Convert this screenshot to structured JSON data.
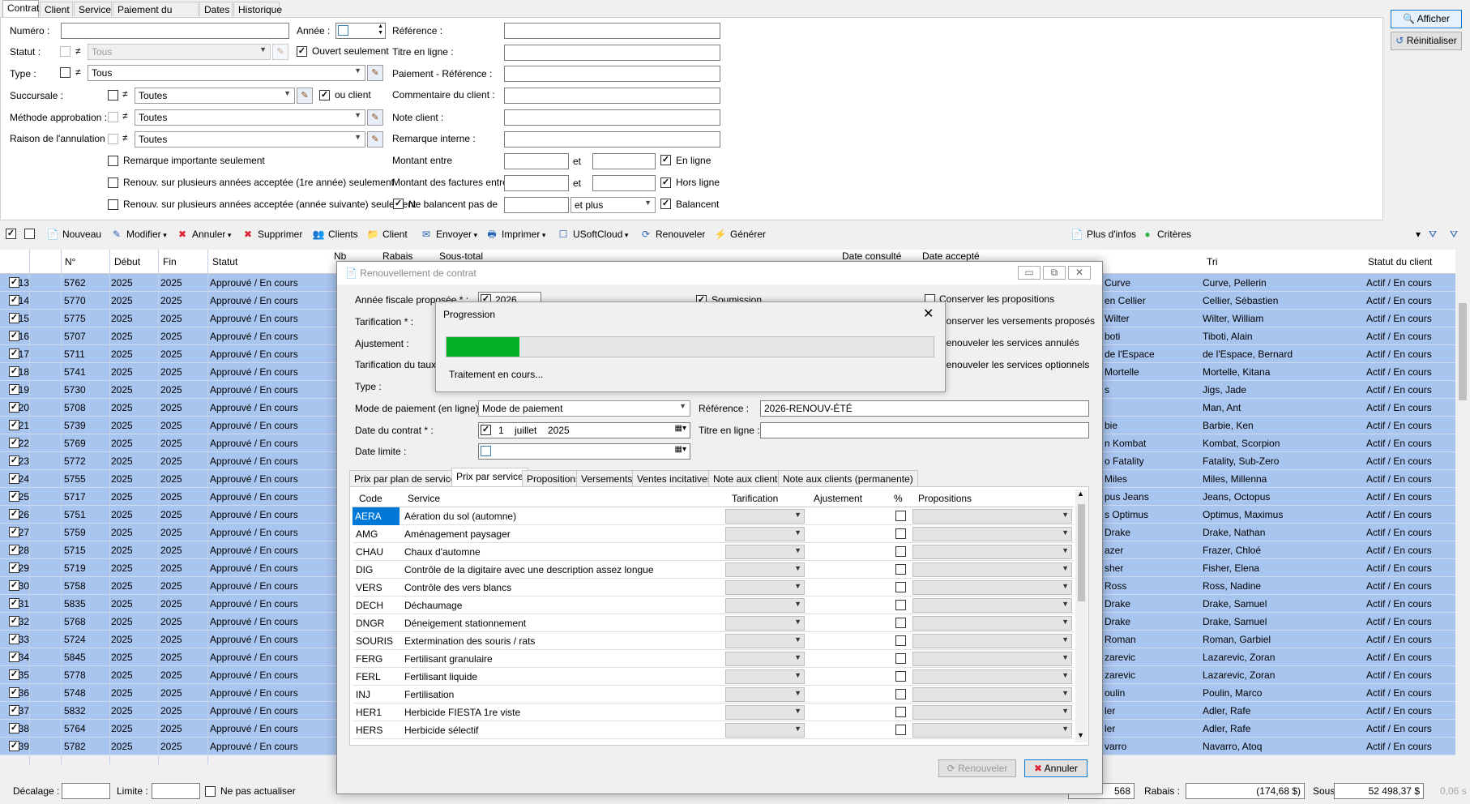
{
  "tabs": [
    "Contrat",
    "Client",
    "Service",
    "Paiement du contrat",
    "Dates",
    "Historique"
  ],
  "filters": {
    "numero_label": "Numéro :",
    "annee_label": "Année :",
    "statut_label": "Statut :",
    "statut_value": "Tous",
    "ouvert_label": "Ouvert seulement",
    "type_label": "Type :",
    "type_value": "Tous",
    "succursale_label": "Succursale :",
    "succursale_value": "Toutes",
    "ou_client_label": "ou client",
    "methode_label": "Méthode approbation :",
    "methode_value": "Toutes",
    "raison_label": "Raison de l'annulation :",
    "raison_value": "Toutes",
    "remarque_importante": "Remarque importante seulement",
    "renouv_1re": "Renouv. sur plusieurs années acceptée (1re année) seulement",
    "renouv_suivante": "Renouv. sur plusieurs années acceptée (année suivante) seulement",
    "reference_label": "Référence :",
    "titre_label": "Titre en ligne :",
    "paiement_ref_label": "Paiement - Référence :",
    "commentaire_label": "Commentaire du client :",
    "note_client_label": "Note client :",
    "remarque_interne_label": "Remarque interne :",
    "montant_label": "Montant entre",
    "montant_factures_label": "Montant des factures entre",
    "ne_balancent_label": "Ne balancent pas de",
    "et": "et",
    "et_plus": "et plus",
    "en_ligne": "En ligne",
    "hors_ligne": "Hors ligne",
    "balancent": "Balancent",
    "neq": "≠"
  },
  "buttons": {
    "afficher": "Afficher",
    "reinitialiser": "Réinitialiser"
  },
  "toolbar": [
    "Nouveau",
    "Modifier",
    "Annuler",
    "Supprimer",
    "Clients",
    "Client",
    "Envoyer",
    "Imprimer",
    "USoftCloud",
    "Renouveler",
    "Générer",
    "Plus d'infos",
    "Critères"
  ],
  "grid": {
    "headers": [
      "N°",
      "Début",
      "Fin",
      "Statut",
      "Nb",
      "Rabais",
      "Sous-total",
      "Date consulté",
      "Date accepté",
      "Tri",
      "Statut du client"
    ],
    "rows": [
      [
        "13",
        "5762",
        "2025",
        "2025",
        "Approuvé / En cours",
        "Curve",
        "Curve, Pellerin",
        "Actif / En cours"
      ],
      [
        "14",
        "5770",
        "2025",
        "2025",
        "Approuvé / En cours",
        "en Cellier",
        "Cellier, Sébastien",
        "Actif / En cours"
      ],
      [
        "15",
        "5775",
        "2025",
        "2025",
        "Approuvé / En cours",
        "Wilter",
        "Wilter, William",
        "Actif / En cours"
      ],
      [
        "16",
        "5707",
        "2025",
        "2025",
        "Approuvé / En cours",
        "boti",
        "Tiboti, Alain",
        "Actif / En cours"
      ],
      [
        "17",
        "5711",
        "2025",
        "2025",
        "Approuvé / En cours",
        "de l'Espace",
        "de l'Espace, Bernard",
        "Actif / En cours"
      ],
      [
        "18",
        "5741",
        "2025",
        "2025",
        "Approuvé / En cours",
        "Mortelle",
        "Mortelle, Kitana",
        "Actif / En cours"
      ],
      [
        "19",
        "5730",
        "2025",
        "2025",
        "Approuvé / En cours",
        "s",
        "Jigs, Jade",
        "Actif / En cours"
      ],
      [
        "20",
        "5708",
        "2025",
        "2025",
        "Approuvé / En cours",
        "",
        "Man, Ant",
        "Actif / En cours"
      ],
      [
        "21",
        "5739",
        "2025",
        "2025",
        "Approuvé / En cours",
        "bie",
        "Barbie, Ken",
        "Actif / En cours"
      ],
      [
        "22",
        "5769",
        "2025",
        "2025",
        "Approuvé / En cours",
        "n Kombat",
        "Kombat, Scorpion",
        "Actif / En cours"
      ],
      [
        "23",
        "5772",
        "2025",
        "2025",
        "Approuvé / En cours",
        "o Fatality",
        "Fatality, Sub-Zero",
        "Actif / En cours"
      ],
      [
        "24",
        "5755",
        "2025",
        "2025",
        "Approuvé / En cours",
        "Miles",
        "Miles, Millenna",
        "Actif / En cours"
      ],
      [
        "25",
        "5717",
        "2025",
        "2025",
        "Approuvé / En cours",
        "pus Jeans",
        "Jeans, Octopus",
        "Actif / En cours"
      ],
      [
        "26",
        "5751",
        "2025",
        "2025",
        "Approuvé / En cours",
        "s Optimus",
        "Optimus, Maximus",
        "Actif / En cours"
      ],
      [
        "27",
        "5759",
        "2025",
        "2025",
        "Approuvé / En cours",
        "Drake",
        "Drake, Nathan",
        "Actif / En cours"
      ],
      [
        "28",
        "5715",
        "2025",
        "2025",
        "Approuvé / En cours",
        "azer",
        "Frazer, Chloé",
        "Actif / En cours"
      ],
      [
        "29",
        "5719",
        "2025",
        "2025",
        "Approuvé / En cours",
        "sher",
        "Fisher, Elena",
        "Actif / En cours"
      ],
      [
        "30",
        "5758",
        "2025",
        "2025",
        "Approuvé / En cours",
        "Ross",
        "Ross, Nadine",
        "Actif / En cours"
      ],
      [
        "31",
        "5835",
        "2025",
        "2025",
        "Approuvé / En cours",
        "Drake",
        "Drake, Samuel",
        "Actif / En cours"
      ],
      [
        "32",
        "5768",
        "2025",
        "2025",
        "Approuvé / En cours",
        "Drake",
        "Drake, Samuel",
        "Actif / En cours"
      ],
      [
        "33",
        "5724",
        "2025",
        "2025",
        "Approuvé / En cours",
        "Roman",
        "Roman, Garbiel",
        "Actif / En cours"
      ],
      [
        "34",
        "5845",
        "2025",
        "2025",
        "Approuvé / En cours",
        "zarevic",
        "Lazarevic, Zoran",
        "Actif / En cours"
      ],
      [
        "35",
        "5778",
        "2025",
        "2025",
        "Approuvé / En cours",
        "zarevic",
        "Lazarevic, Zoran",
        "Actif / En cours"
      ],
      [
        "36",
        "5748",
        "2025",
        "2025",
        "Approuvé / En cours",
        "oulin",
        "Poulin, Marco",
        "Actif / En cours"
      ],
      [
        "37",
        "5832",
        "2025",
        "2025",
        "Approuvé / En cours",
        "ler",
        "Adler, Rafe",
        "Actif / En cours"
      ],
      [
        "38",
        "5764",
        "2025",
        "2025",
        "Approuvé / En cours",
        "ler",
        "Adler, Rafe",
        "Actif / En cours"
      ],
      [
        "39",
        "5782",
        "2025",
        "2025",
        "Approuvé / En cours",
        "varro",
        "Navarro, Atoq",
        "Actif / En cours"
      ]
    ]
  },
  "footer": {
    "decalage_label": "Décalage :",
    "limite_label": "Limite :",
    "ne_pas_actualiser": "Ne pas actualiser",
    "count": "568",
    "rabais_label": "Rabais :",
    "rabais_value": "(174,68 $)",
    "sous_total_label": "Sous-total :",
    "sous_total_value": "52 498,37 $",
    "extra": "0,06 s"
  },
  "modal": {
    "title": "Renouvellement de contrat",
    "annee_label": "Année fiscale proposée * :",
    "annee_value": "2026",
    "soumission": "Soumission",
    "conserver": "Conserver les propositions",
    "conserver_versements": "Conserver les versements proposés",
    "renouveler_annules": "Renouveler les services annulés",
    "renouveler_optionnels": "Renouveler les services optionnels",
    "tarification_label": "Tarification * :",
    "ajustement_label": "Ajustement :",
    "tarif_taux_label": "Tarification du taux h",
    "type_label": "Type :",
    "mode_label": "Mode de paiement (en ligne) :",
    "mode_value": "Mode de paiement",
    "reference_label": "Référence :",
    "reference_value": "2026-RENOUV-ÉTÉ",
    "date_label": "Date du contrat * :",
    "date_day": "1",
    "date_month": "juillet",
    "date_year": "2025",
    "titre_label": "Titre en ligne :",
    "date_limite_label": "Date limite :",
    "tabs": [
      "Prix par plan de services",
      "Prix par service",
      "Propositions",
      "Versements",
      "Ventes incitatives",
      "Note aux clients",
      "Note aux clients (permanente)"
    ],
    "col_headers": [
      "Code",
      "Service",
      "Tarification",
      "Ajustement",
      "%",
      "Propositions"
    ],
    "services": [
      [
        "AERA",
        "Aération du sol (automne)"
      ],
      [
        "AMG",
        "Aménagement paysager"
      ],
      [
        "CHAU",
        "Chaux d'automne"
      ],
      [
        "DIG",
        "Contrôle de la digitaire avec une description assez longue"
      ],
      [
        "VERS",
        "Contrôle des vers blancs"
      ],
      [
        "DECH",
        "Déchaumage"
      ],
      [
        "DNGR",
        "Déneigement stationnement"
      ],
      [
        "SOURIS",
        "Extermination des souris / rats"
      ],
      [
        "FERG",
        "Fertilisant granulaire"
      ],
      [
        "FERL",
        "Fertilisant liquide"
      ],
      [
        "INJ",
        "Fertilisation"
      ],
      [
        "HER1",
        "Herbicide FIESTA 1re viste"
      ],
      [
        "HERS",
        "Herbicide sélectif"
      ]
    ],
    "renouveler_btn": "Renouveler",
    "annuler_btn": "Annuler"
  },
  "progress": {
    "title": "Progression",
    "status": "Traitement en cours...",
    "fill_fraction": 0.15,
    "fill_color": "#06b025"
  }
}
